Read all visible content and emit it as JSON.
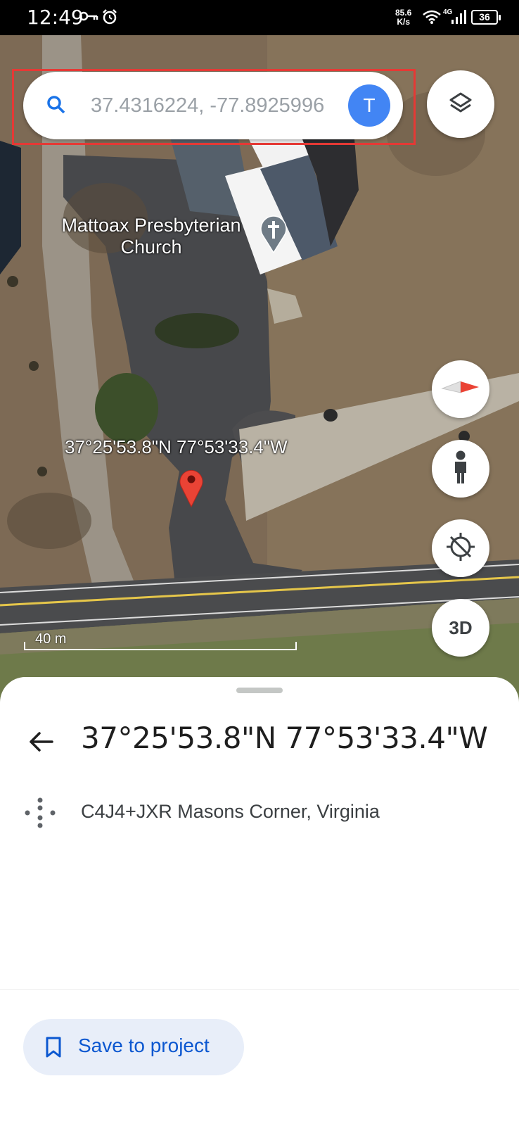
{
  "status_bar": {
    "time": "12:49",
    "speed_value": "85.6",
    "speed_unit": "K/s",
    "network": "4G",
    "battery": "36"
  },
  "search": {
    "value": "37.4316224, -77.8925996",
    "avatar_initial": "T"
  },
  "map": {
    "place_name": "Mattoax Presbyterian Church",
    "pin_coordinates": "37°25'53.8\"N 77°53'33.4\"W",
    "scale": "40 m",
    "three_d_label": "3D"
  },
  "sheet": {
    "title": "37°25'53.8\"N 77°53'33.4\"W",
    "plus_code": "C4J4+JXR Masons Corner, Virginia",
    "save_label": "Save to project"
  },
  "colors": {
    "accent": "#4285f4",
    "pin_red": "#ea4335",
    "highlight_red": "#e53935",
    "save_text": "#0b57d0",
    "save_bg": "#e8eef9"
  },
  "icons": [
    "key-icon",
    "alarm-icon",
    "wifi-icon",
    "signal-icon",
    "battery-icon",
    "search-icon",
    "layers-icon",
    "compass-icon",
    "pegman-icon",
    "location-off-icon",
    "church-pin-icon",
    "red-pin-icon",
    "back-arrow-icon",
    "plus-code-icon",
    "bookmark-icon"
  ]
}
